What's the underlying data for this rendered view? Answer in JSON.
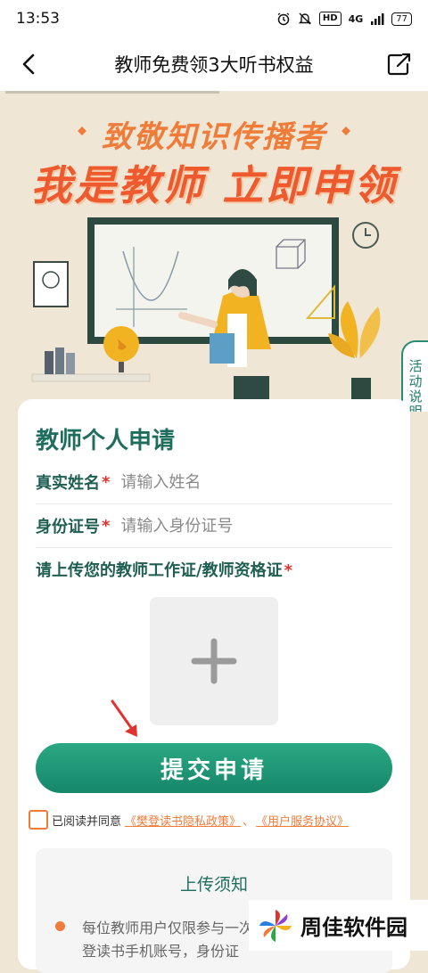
{
  "status_bar": {
    "time": "13:53",
    "hd": "HD",
    "network": "4G",
    "battery": "77"
  },
  "nav": {
    "title": "教师免费领3大听书权益",
    "back_icon": "chevron-left-icon",
    "share_icon": "share-icon"
  },
  "banner": {
    "slogan_top": "致敬知识传播者",
    "slogan_main": "我是教师 立即申领",
    "side_tab": "活动说明"
  },
  "form": {
    "title": "教师个人申请",
    "name_label": "真实姓名",
    "name_placeholder": "请输入姓名",
    "id_label": "身份证号",
    "id_placeholder": "请输入身份证号",
    "required_mark": "*",
    "upload_label": "请上传您的教师工作证/教师资格证",
    "submit_label": "提交申请",
    "agree_prefix": "已阅读并同意",
    "privacy_link": "《樊登读书隐私政策》",
    "separator": "、",
    "terms_link": "《用户服务协议》"
  },
  "notice": {
    "title": "上传须知",
    "line1": "每位教师用户仅限参与一次",
    "line2": "登读书手机账号，身份证"
  },
  "watermark": {
    "text": "周佳软件园"
  },
  "colors": {
    "brand_green": "#16876a",
    "accent_orange": "#f07c3a",
    "required_red": "#e0322e"
  }
}
